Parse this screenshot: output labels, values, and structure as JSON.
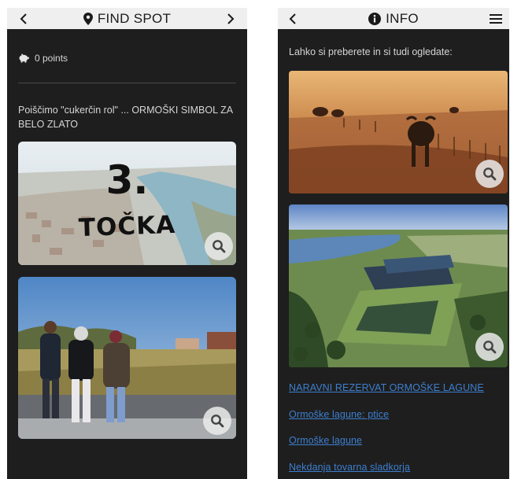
{
  "left": {
    "header_title": "FIND SPOT",
    "points": "0 points",
    "clue": "Poiščimo \"cukerčin rol\" ... ORMOŠKI SIMBOL ZA BELO ZLATO",
    "card1_number": "3.",
    "card1_label": "TOČKA"
  },
  "right": {
    "header_title": "INFO",
    "intro": "Lahko si preberete in si tudi ogledate:",
    "links": [
      "NARAVNI REZERVAT ORMOŠKE LAGUNE",
      "Ormoške lagune: ptice",
      "Ormoške lagune",
      "Nekdanja tovarna sladkorja"
    ]
  },
  "colors": {
    "app_bg": "#1e1e1e",
    "header_bg": "#efefef",
    "link": "#3d7fd0"
  },
  "icons": [
    "chevron-left-icon",
    "chevron-right-icon",
    "map-pin-icon",
    "piggy-bank-icon",
    "info-circle-icon",
    "hamburger-menu-icon",
    "search-icon"
  ]
}
